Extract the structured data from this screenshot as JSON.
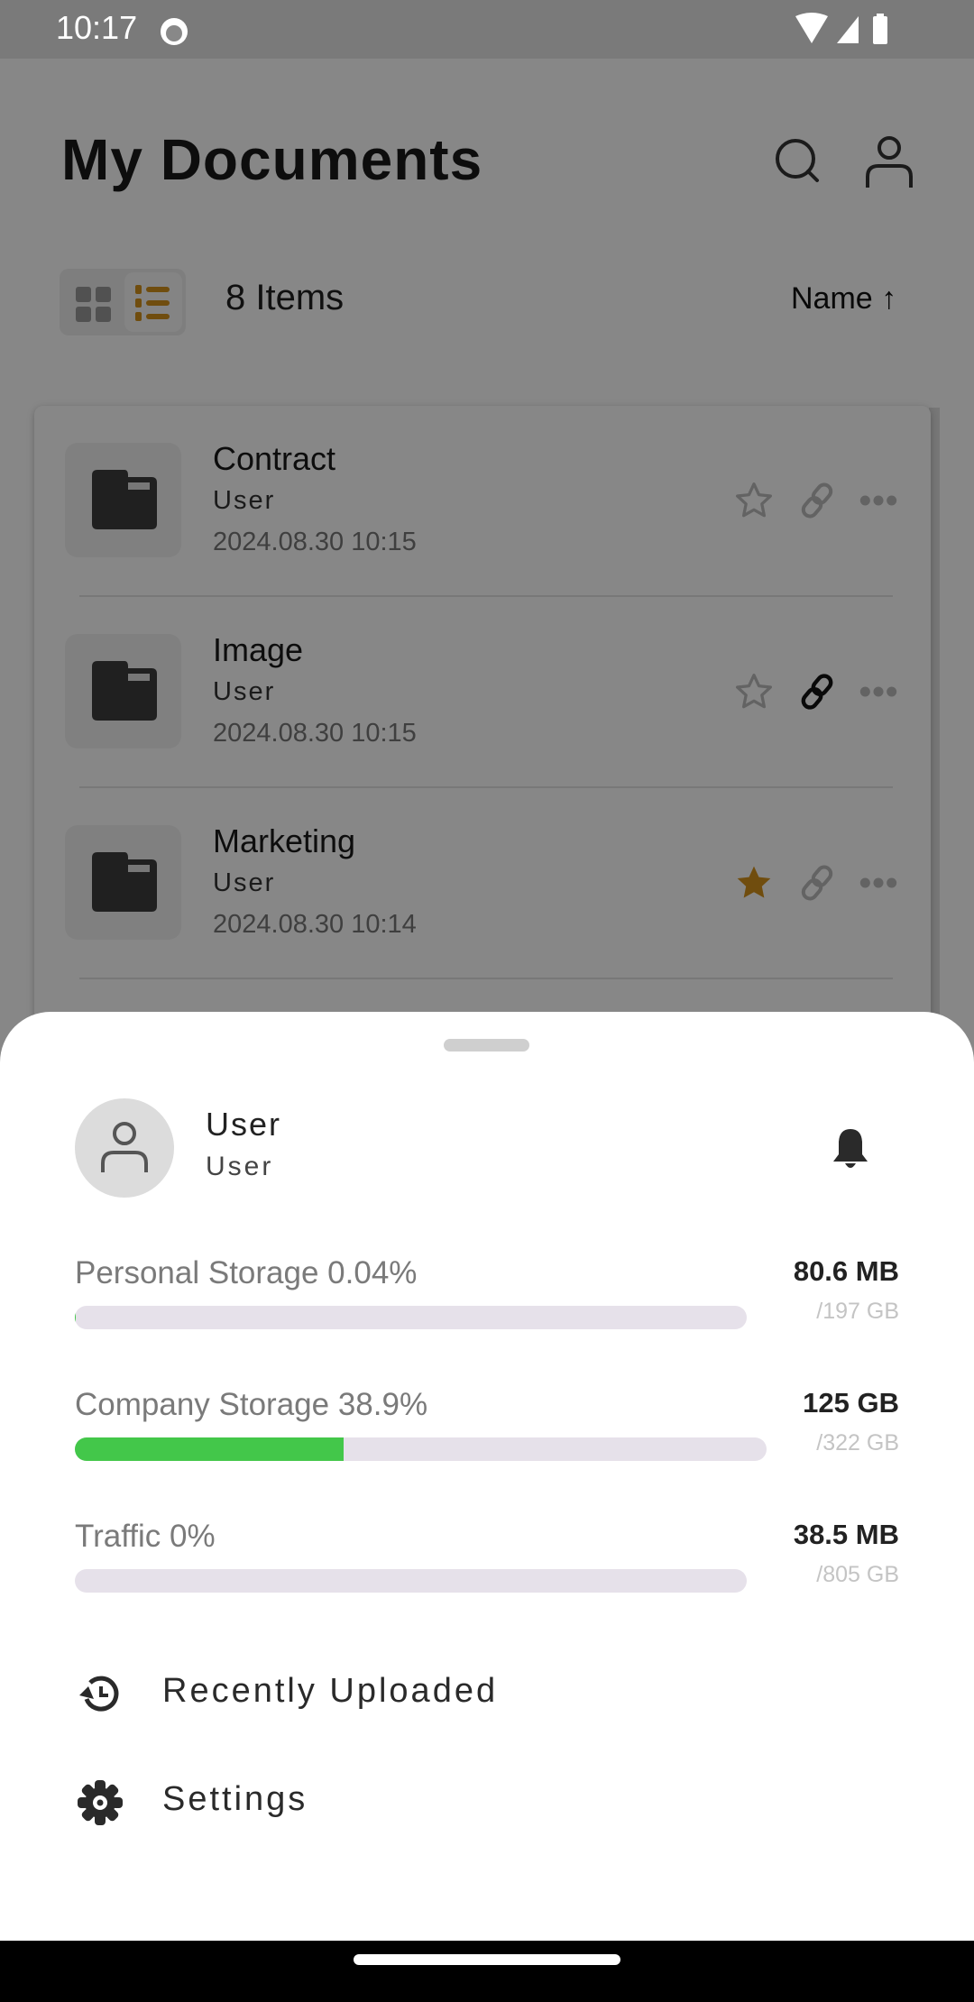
{
  "status_bar": {
    "time": "10:17",
    "icons": [
      "cat-notification-icon",
      "wifi-icon",
      "signal-icon",
      "battery-icon"
    ]
  },
  "header": {
    "title": "My Documents",
    "search_icon": "search-icon",
    "profile_icon": "person-icon"
  },
  "toolbar": {
    "view_modes": [
      "grid",
      "list"
    ],
    "active_view": "list",
    "item_count": "8 Items",
    "sort_label": "Name",
    "sort_direction_icon": "arrow-up-icon"
  },
  "files": [
    {
      "name": "Contract",
      "owner": "User",
      "date": "2024.08.30 10:15",
      "starred": false,
      "linked": false
    },
    {
      "name": "Image",
      "owner": "User",
      "date": "2024.08.30 10:15",
      "starred": false,
      "linked": true
    },
    {
      "name": "Marketing",
      "owner": "User",
      "date": "2024.08.30 10:14",
      "starred": true,
      "linked": false
    }
  ],
  "sheet": {
    "user": {
      "name": "User",
      "role": "User"
    },
    "storage": [
      {
        "label": "Personal Storage 0.04%",
        "used": "80.6 MB",
        "total": "/197 GB",
        "percent": 0.04
      },
      {
        "label": "Company Storage 38.9%",
        "used": "125 GB",
        "total": "/322 GB",
        "percent": 38.9
      },
      {
        "label": "Traffic 0%",
        "used": "38.5 MB",
        "total": "/805 GB",
        "percent": 0
      }
    ],
    "menu": [
      {
        "label": "Recently Uploaded",
        "icon": "history-icon"
      },
      {
        "label": "Settings",
        "icon": "gear-icon"
      }
    ]
  },
  "colors": {
    "accent": "#d4921c",
    "progress": "#43c74a",
    "track": "#e6e1ea"
  }
}
